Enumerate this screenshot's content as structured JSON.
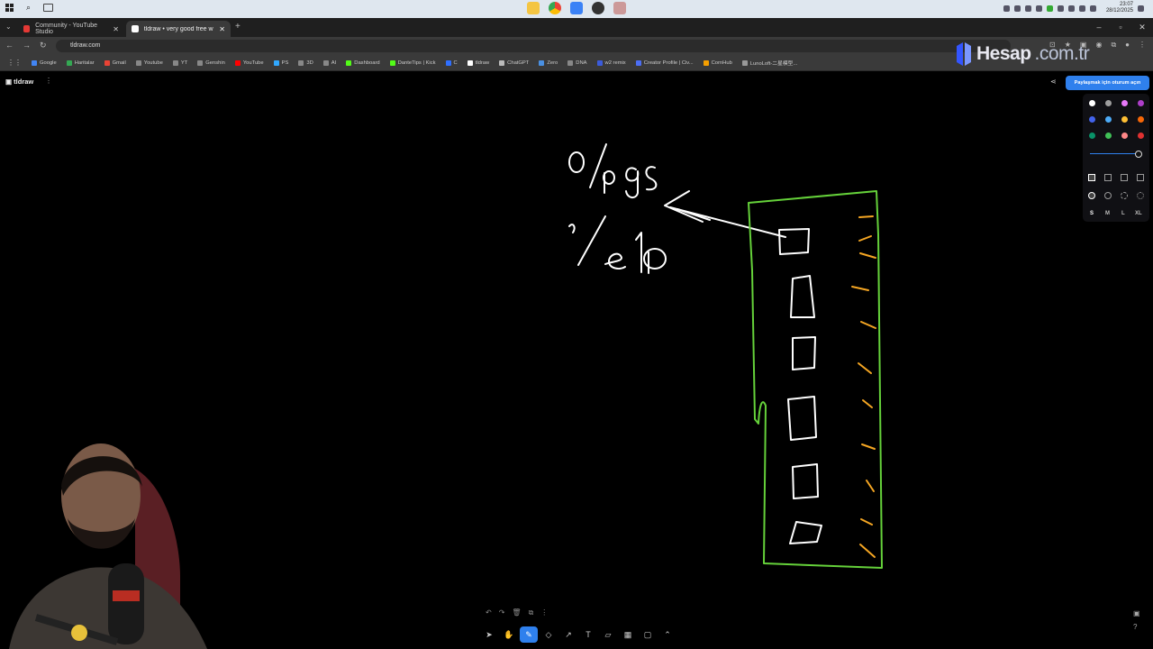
{
  "os": {
    "clock_time": "23:07",
    "clock_date": "28/12/2025"
  },
  "tabs": [
    {
      "label": "Community - YouTube Studio",
      "favicon_color": "#e53935",
      "active": false
    },
    {
      "label": "tldraw • very good free whitebo",
      "favicon_color": "#ffffff",
      "active": true
    }
  ],
  "address": {
    "url": "tldraw.com"
  },
  "bookmarks": [
    {
      "label": "Google",
      "color": "#4285f4"
    },
    {
      "label": "Haritalar",
      "color": "#34a853"
    },
    {
      "label": "Gmail",
      "color": "#ea4335"
    },
    {
      "label": "Youtube",
      "color": "#888888"
    },
    {
      "label": "YT",
      "color": "#888888"
    },
    {
      "label": "Genshin",
      "color": "#888888"
    },
    {
      "label": "YouTube",
      "color": "#ff0000"
    },
    {
      "label": "PS",
      "color": "#31a8ff"
    },
    {
      "label": "3D",
      "color": "#888888"
    },
    {
      "label": "AI",
      "color": "#888888"
    },
    {
      "label": "Dashboard",
      "color": "#53fc18"
    },
    {
      "label": "DanteTips | Kick",
      "color": "#53fc18"
    },
    {
      "label": "C",
      "color": "#2f6fff"
    },
    {
      "label": "tldraw",
      "color": "#ffffff"
    },
    {
      "label": "ChatGPT",
      "color": "#bbbbbb"
    },
    {
      "label": "Zero",
      "color": "#4a90e2"
    },
    {
      "label": "DNA",
      "color": "#888888"
    },
    {
      "label": "w2 remix",
      "color": "#3b5bdb"
    },
    {
      "label": "Creator Profile | Civ...",
      "color": "#4c6ef5"
    },
    {
      "label": "CornHub",
      "color": "#f59f00"
    },
    {
      "label": "LunoLoft-二星模型...",
      "color": "#999999"
    }
  ],
  "watermark": {
    "brand": "Hesap",
    "suffix": ".com.tr"
  },
  "app": {
    "logo": "tldraw",
    "share_button": "Paylaşmak için oturum açın"
  },
  "style_panel": {
    "colors": [
      "#ffffff",
      "#9e9e9e",
      "#e879f9",
      "#ae3ec9",
      "#4263eb",
      "#4dabf7",
      "#ffc034",
      "#f76707",
      "#099268",
      "#40c057",
      "#ff8787",
      "#e03131"
    ],
    "sizes": [
      "S",
      "M",
      "L",
      "XL"
    ],
    "selected_size": "S"
  },
  "canvas_notes": {
    "stroke_white": "#ffffff",
    "stroke_green": "#65d13a",
    "stroke_orange": "#f5a623"
  },
  "toolbar": {
    "tools": [
      "select",
      "hand",
      "draw",
      "eraser",
      "arrow",
      "text",
      "note",
      "asset",
      "rectangle",
      "more"
    ],
    "active_tool": "draw"
  }
}
